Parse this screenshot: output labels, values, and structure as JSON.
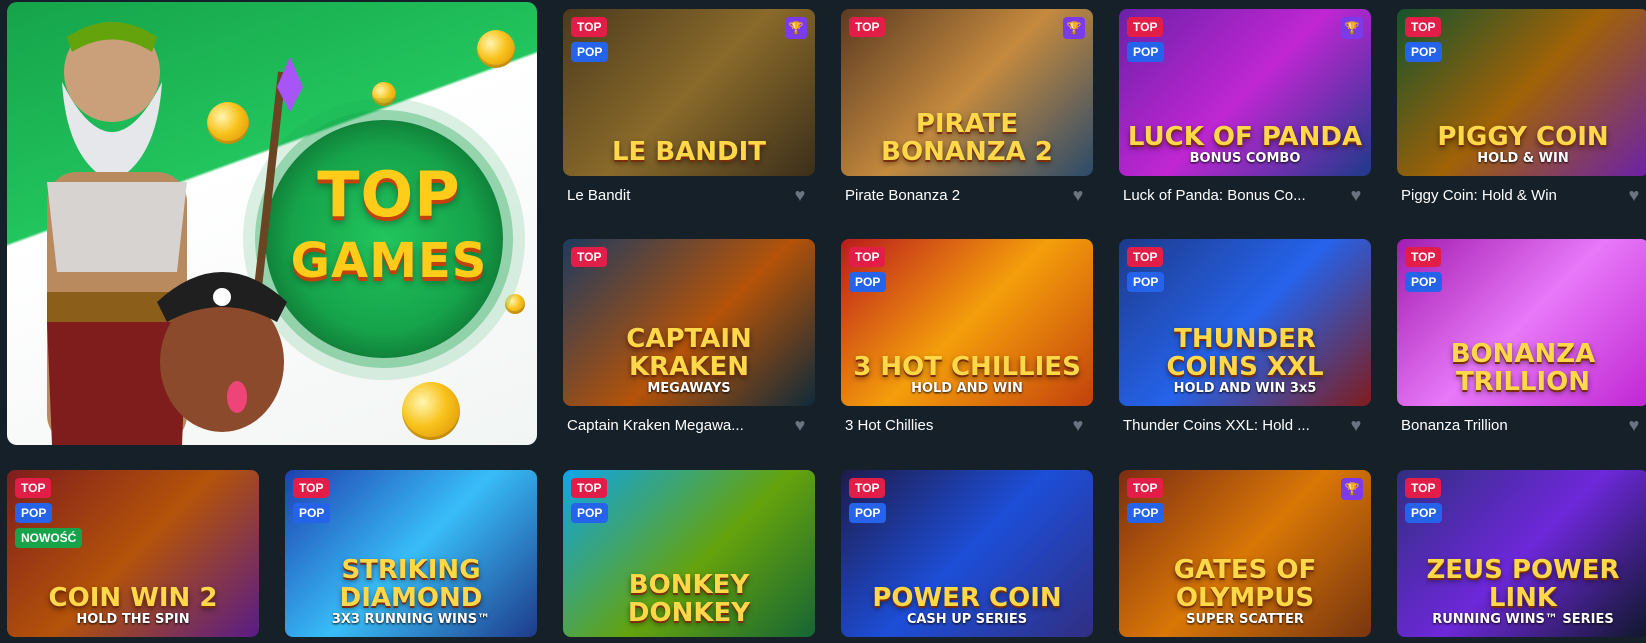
{
  "promo": {
    "title_line1": "TOP",
    "title_line2": "GAMES"
  },
  "icons": {
    "trophy": "trophy-icon",
    "heart": "heart-icon"
  },
  "colors": {
    "background": "#152029",
    "badge_top": "#e11d48",
    "badge_pop": "#2563eb",
    "badge_new": "#16a34a",
    "trophy": "#7c3aed"
  },
  "games": [
    {
      "name": "Le Bandit",
      "art_title": "LE BANDIT",
      "art_sub": "",
      "badges": [
        "TOP",
        "POP"
      ],
      "trophy": true,
      "bg": "linear-gradient(135deg,#4a3a1e,#8a6a2a 50%,#3b2f1a)"
    },
    {
      "name": "Pirate Bonanza 2",
      "art_title": "PIRATE BONANZA 2",
      "art_sub": "",
      "badges": [
        "TOP"
      ],
      "trophy": true,
      "bg": "linear-gradient(135deg,#5a3a22,#c58a3e 50%,#2a4a6a)"
    },
    {
      "name": "Luck of Panda: Bonus Co...",
      "art_title": "LUCK OF PANDA",
      "art_sub": "BONUS COMBO",
      "badges": [
        "TOP",
        "POP"
      ],
      "trophy": true,
      "bg": "linear-gradient(135deg,#6b21a8,#c026d3 50%,#1e3a8a)"
    },
    {
      "name": "Piggy Coin: Hold & Win",
      "art_title": "PIGGY COIN",
      "art_sub": "HOLD & WIN",
      "badges": [
        "TOP",
        "POP"
      ],
      "trophy": false,
      "bg": "linear-gradient(135deg,#14532d,#a16207 50%,#6b21a8)"
    },
    {
      "name": "Captain Kraken Megawa...",
      "art_title": "CAPTAIN KRAKEN",
      "art_sub": "MEGAWAYS",
      "badges": [
        "TOP"
      ],
      "trophy": false,
      "bg": "linear-gradient(135deg,#1e3a5f,#b45309 55%,#0f2a3a)"
    },
    {
      "name": "3 Hot Chillies",
      "art_title": "3 HOT CHILLIES",
      "art_sub": "HOLD AND WIN",
      "badges": [
        "TOP",
        "POP"
      ],
      "trophy": false,
      "bg": "linear-gradient(135deg,#b91c1c,#f59e0b 50%,#c2410c)"
    },
    {
      "name": "Thunder Coins XXL: Hold ...",
      "art_title": "THUNDER COINS XXL",
      "art_sub": "HOLD AND WIN 3x5",
      "badges": [
        "TOP",
        "POP"
      ],
      "trophy": false,
      "bg": "linear-gradient(135deg,#1e3a8a,#2563eb 50%,#7f1d1d)"
    },
    {
      "name": "Bonanza Trillion",
      "art_title": "BONANZA TRILLION",
      "art_sub": "",
      "badges": [
        "TOP",
        "POP"
      ],
      "trophy": false,
      "bg": "linear-gradient(135deg,#a21caf,#e879f9 50%,#c026d3)"
    },
    {
      "name": "",
      "art_title": "COIN WIN 2",
      "art_sub": "HOLD THE SPIN",
      "badges": [
        "TOP",
        "POP",
        "NOWOŚĆ"
      ],
      "trophy": false,
      "bg": "linear-gradient(135deg,#7f1d1d,#b45309 50%,#581c87)"
    },
    {
      "name": "",
      "art_title": "STRIKING DIAMOND",
      "art_sub": "3X3 RUNNING WINS™",
      "badges": [
        "TOP",
        "POP"
      ],
      "trophy": false,
      "bg": "linear-gradient(135deg,#1e40af,#38bdf8 50%,#1e3a8a)"
    },
    {
      "name": "",
      "art_title": "BONKEY DONKEY",
      "art_sub": "",
      "badges": [
        "TOP",
        "POP"
      ],
      "trophy": false,
      "bg": "linear-gradient(135deg,#0ea5e9,#65a30d 55%,#166534)"
    },
    {
      "name": "",
      "art_title": "POWER COIN",
      "art_sub": "CASH UP SERIES",
      "badges": [
        "TOP",
        "POP"
      ],
      "trophy": false,
      "bg": "linear-gradient(135deg,#1e1b4b,#1d4ed8 50%,#312e81)"
    },
    {
      "name": "",
      "art_title": "GATES OF OLYMPUS",
      "art_sub": "SUPER SCATTER",
      "badges": [
        "TOP",
        "POP"
      ],
      "trophy": true,
      "bg": "linear-gradient(135deg,#7c2d12,#d97706 50%,#78350f)"
    },
    {
      "name": "",
      "art_title": "ZEUS POWER LINK",
      "art_sub": "RUNNING WINS™ SERIES",
      "badges": [
        "TOP",
        "POP"
      ],
      "trophy": false,
      "bg": "linear-gradient(135deg,#312e81,#6d28d9 50%,#0f172a)"
    }
  ]
}
